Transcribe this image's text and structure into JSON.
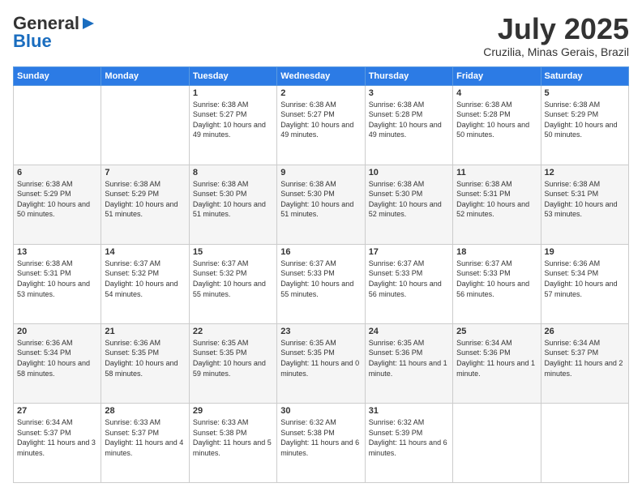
{
  "header": {
    "logo_general": "General",
    "logo_blue": "Blue",
    "month_title": "July 2025",
    "location": "Cruzilia, Minas Gerais, Brazil"
  },
  "weekdays": [
    "Sunday",
    "Monday",
    "Tuesday",
    "Wednesday",
    "Thursday",
    "Friday",
    "Saturday"
  ],
  "weeks": [
    [
      {
        "day": "",
        "info": ""
      },
      {
        "day": "",
        "info": ""
      },
      {
        "day": "1",
        "info": "Sunrise: 6:38 AM\nSunset: 5:27 PM\nDaylight: 10 hours and 49 minutes."
      },
      {
        "day": "2",
        "info": "Sunrise: 6:38 AM\nSunset: 5:27 PM\nDaylight: 10 hours and 49 minutes."
      },
      {
        "day": "3",
        "info": "Sunrise: 6:38 AM\nSunset: 5:28 PM\nDaylight: 10 hours and 49 minutes."
      },
      {
        "day": "4",
        "info": "Sunrise: 6:38 AM\nSunset: 5:28 PM\nDaylight: 10 hours and 50 minutes."
      },
      {
        "day": "5",
        "info": "Sunrise: 6:38 AM\nSunset: 5:29 PM\nDaylight: 10 hours and 50 minutes."
      }
    ],
    [
      {
        "day": "6",
        "info": "Sunrise: 6:38 AM\nSunset: 5:29 PM\nDaylight: 10 hours and 50 minutes."
      },
      {
        "day": "7",
        "info": "Sunrise: 6:38 AM\nSunset: 5:29 PM\nDaylight: 10 hours and 51 minutes."
      },
      {
        "day": "8",
        "info": "Sunrise: 6:38 AM\nSunset: 5:30 PM\nDaylight: 10 hours and 51 minutes."
      },
      {
        "day": "9",
        "info": "Sunrise: 6:38 AM\nSunset: 5:30 PM\nDaylight: 10 hours and 51 minutes."
      },
      {
        "day": "10",
        "info": "Sunrise: 6:38 AM\nSunset: 5:30 PM\nDaylight: 10 hours and 52 minutes."
      },
      {
        "day": "11",
        "info": "Sunrise: 6:38 AM\nSunset: 5:31 PM\nDaylight: 10 hours and 52 minutes."
      },
      {
        "day": "12",
        "info": "Sunrise: 6:38 AM\nSunset: 5:31 PM\nDaylight: 10 hours and 53 minutes."
      }
    ],
    [
      {
        "day": "13",
        "info": "Sunrise: 6:38 AM\nSunset: 5:31 PM\nDaylight: 10 hours and 53 minutes."
      },
      {
        "day": "14",
        "info": "Sunrise: 6:37 AM\nSunset: 5:32 PM\nDaylight: 10 hours and 54 minutes."
      },
      {
        "day": "15",
        "info": "Sunrise: 6:37 AM\nSunset: 5:32 PM\nDaylight: 10 hours and 55 minutes."
      },
      {
        "day": "16",
        "info": "Sunrise: 6:37 AM\nSunset: 5:33 PM\nDaylight: 10 hours and 55 minutes."
      },
      {
        "day": "17",
        "info": "Sunrise: 6:37 AM\nSunset: 5:33 PM\nDaylight: 10 hours and 56 minutes."
      },
      {
        "day": "18",
        "info": "Sunrise: 6:37 AM\nSunset: 5:33 PM\nDaylight: 10 hours and 56 minutes."
      },
      {
        "day": "19",
        "info": "Sunrise: 6:36 AM\nSunset: 5:34 PM\nDaylight: 10 hours and 57 minutes."
      }
    ],
    [
      {
        "day": "20",
        "info": "Sunrise: 6:36 AM\nSunset: 5:34 PM\nDaylight: 10 hours and 58 minutes."
      },
      {
        "day": "21",
        "info": "Sunrise: 6:36 AM\nSunset: 5:35 PM\nDaylight: 10 hours and 58 minutes."
      },
      {
        "day": "22",
        "info": "Sunrise: 6:35 AM\nSunset: 5:35 PM\nDaylight: 10 hours and 59 minutes."
      },
      {
        "day": "23",
        "info": "Sunrise: 6:35 AM\nSunset: 5:35 PM\nDaylight: 11 hours and 0 minutes."
      },
      {
        "day": "24",
        "info": "Sunrise: 6:35 AM\nSunset: 5:36 PM\nDaylight: 11 hours and 1 minute."
      },
      {
        "day": "25",
        "info": "Sunrise: 6:34 AM\nSunset: 5:36 PM\nDaylight: 11 hours and 1 minute."
      },
      {
        "day": "26",
        "info": "Sunrise: 6:34 AM\nSunset: 5:37 PM\nDaylight: 11 hours and 2 minutes."
      }
    ],
    [
      {
        "day": "27",
        "info": "Sunrise: 6:34 AM\nSunset: 5:37 PM\nDaylight: 11 hours and 3 minutes."
      },
      {
        "day": "28",
        "info": "Sunrise: 6:33 AM\nSunset: 5:37 PM\nDaylight: 11 hours and 4 minutes."
      },
      {
        "day": "29",
        "info": "Sunrise: 6:33 AM\nSunset: 5:38 PM\nDaylight: 11 hours and 5 minutes."
      },
      {
        "day": "30",
        "info": "Sunrise: 6:32 AM\nSunset: 5:38 PM\nDaylight: 11 hours and 6 minutes."
      },
      {
        "day": "31",
        "info": "Sunrise: 6:32 AM\nSunset: 5:39 PM\nDaylight: 11 hours and 6 minutes."
      },
      {
        "day": "",
        "info": ""
      },
      {
        "day": "",
        "info": ""
      }
    ]
  ]
}
